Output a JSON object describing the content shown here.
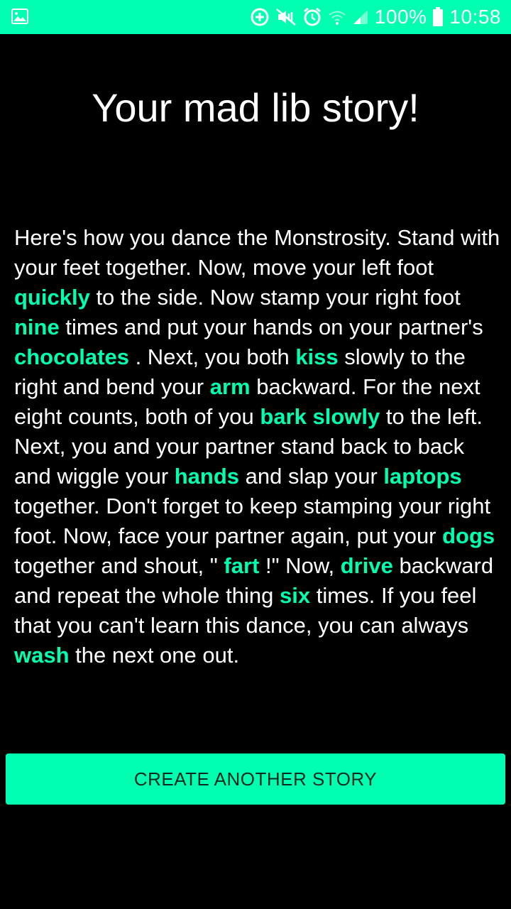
{
  "status_bar": {
    "icons": [
      "image-notification-icon",
      "data-saver-icon",
      "mute-vibrate-icon",
      "alarm-icon",
      "wifi-icon",
      "cell-signal-icon",
      "battery-icon"
    ],
    "battery": "100%",
    "time": "10:58",
    "bg_color": "#00ffb0"
  },
  "title": "Your mad lib story!",
  "story": {
    "s0": "Here's how you dance the Monstrosity. Stand with your feet together. Now, move your left foot ",
    "w0": "quickly",
    "s1": " to the side. Now stamp your right foot ",
    "w1": "nine",
    "s2": " times and put your hands on your partner's ",
    "w2": "chocolates",
    "s3": " . Next, you both ",
    "w3": "kiss",
    "s4": " slowly to the right and bend your ",
    "w4": "arm",
    "s5": " backward. For the next eight counts, both of you ",
    "w5": "bark slowly",
    "s6": " to the left. Next, you and your partner stand back to back and wiggle your ",
    "w6": "hands",
    "s7": " and slap your ",
    "w7": "laptops",
    "s8": " together. Don't forget to keep stamping your right foot. Now, face your partner again, put your ",
    "w8": "dogs",
    "s9": " together and shout, \" ",
    "w9": "fart",
    "s10": " !\" Now, ",
    "w10": "drive",
    "s11": " backward and repeat the whole thing ",
    "w11": "six",
    "s12": " times. If you feel that you can't learn this dance, you can always ",
    "w12": "wash",
    "s13": " the next one out."
  },
  "button": {
    "label": "CREATE ANOTHER STORY"
  },
  "colors": {
    "accent": "#00ffb0",
    "background": "#000000",
    "text": "#ffffff"
  }
}
